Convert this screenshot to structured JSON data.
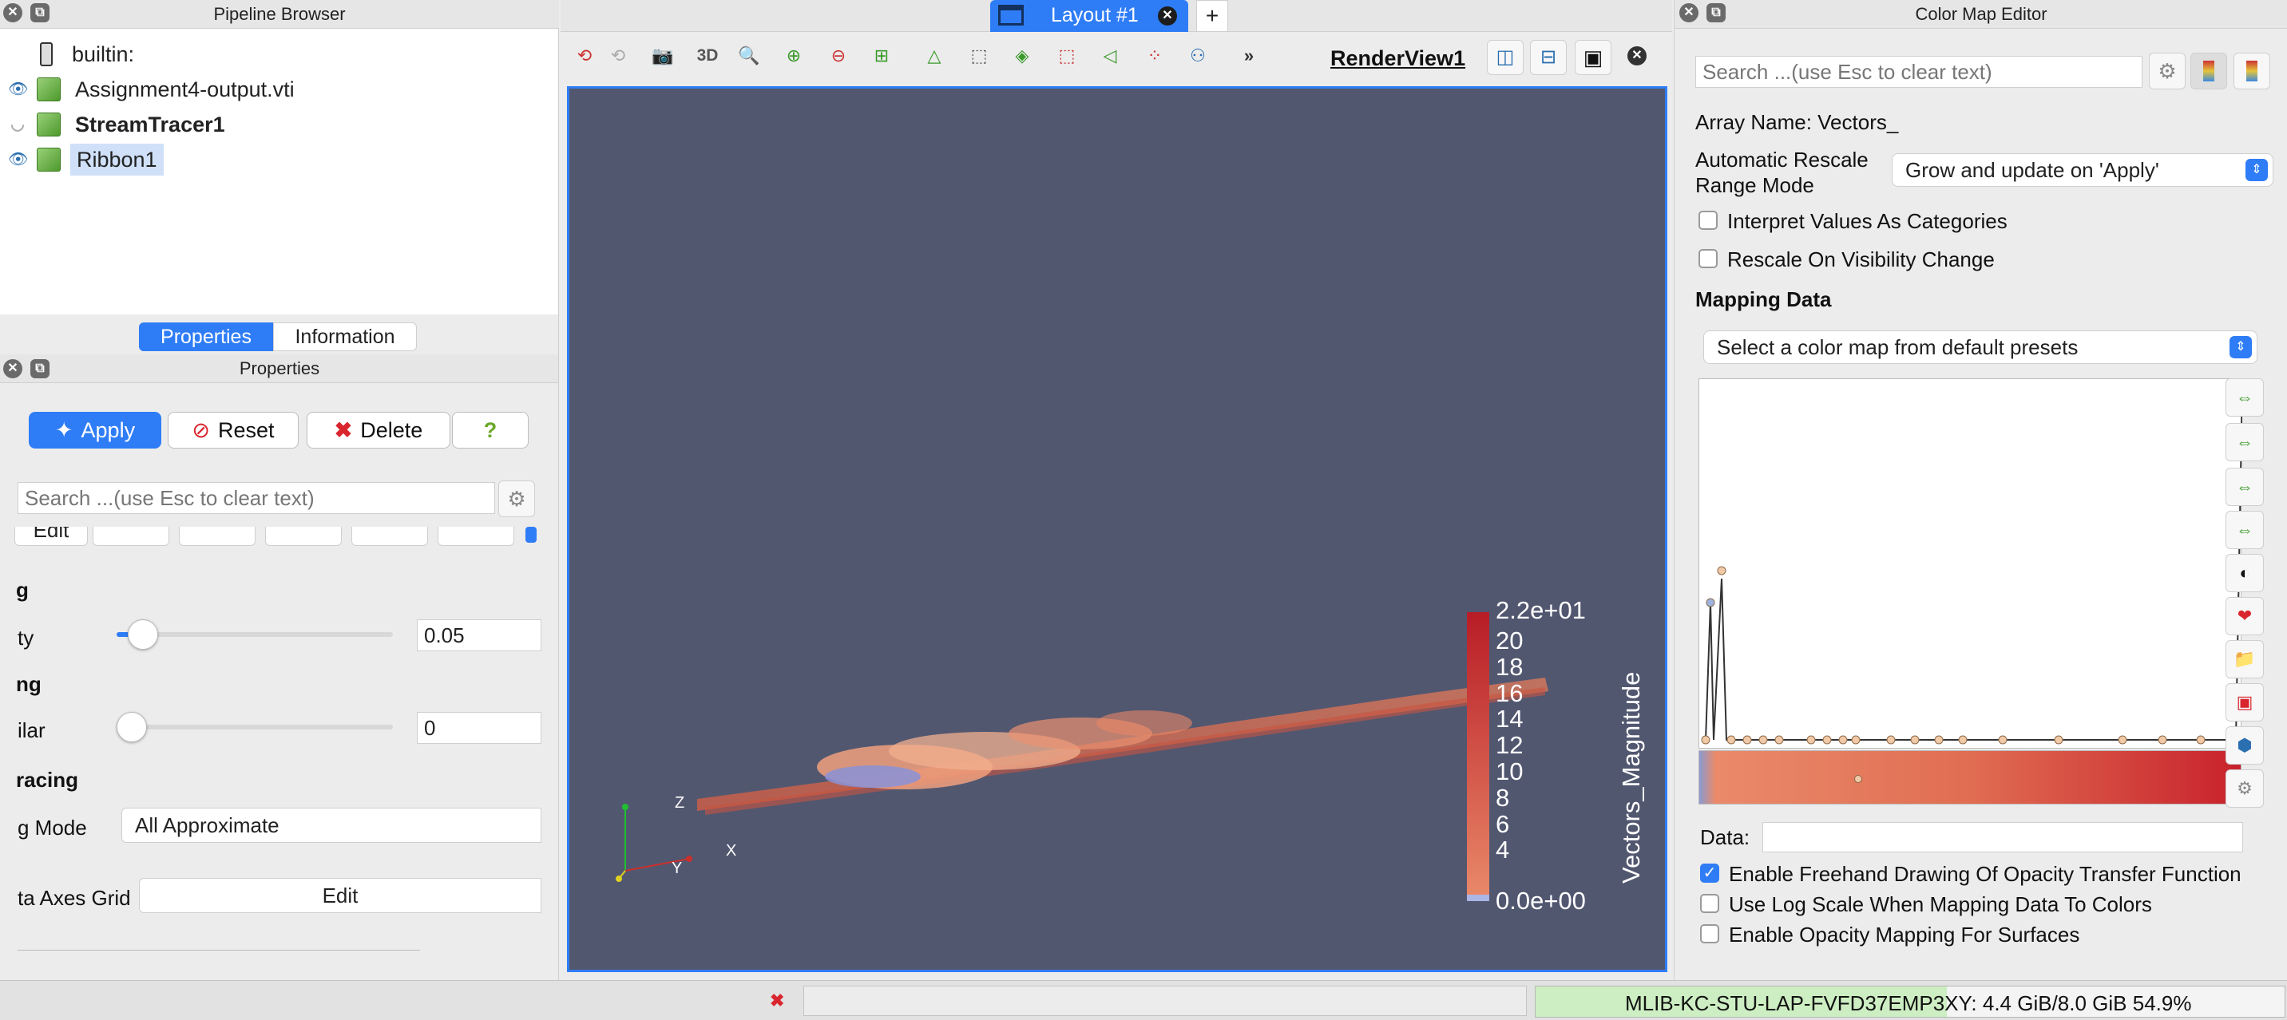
{
  "pipeline_browser": {
    "title": "Pipeline Browser",
    "items": [
      {
        "label": "builtin:"
      },
      {
        "label": "Assignment4-output.vti"
      },
      {
        "label": "StreamTracer1"
      },
      {
        "label": "Ribbon1"
      }
    ]
  },
  "panel_tabs": {
    "properties": "Properties",
    "information": "Information"
  },
  "properties": {
    "title": "Properties",
    "apply": "Apply",
    "reset": "Reset",
    "delete": "Delete",
    "help": "?",
    "search_placeholder": "Search ...(use Esc to clear text)",
    "edit_fragment": "Edit",
    "section1": "g",
    "row1_label": "ty",
    "row1_value": "0.05",
    "section2": "ng",
    "row2_label": "ilar",
    "row2_value": "0",
    "section3": "racing",
    "row3_label": "g Mode",
    "row3_value": "All Approximate",
    "row4_label": "ta Axes Grid",
    "row4_button": "Edit"
  },
  "layout_tab": {
    "label": "Layout #1",
    "add": "+"
  },
  "render_view": {
    "title": "RenderView1",
    "tool_3d": "3D",
    "colorbar": {
      "title": "Vectors_Magnitude",
      "ticks": [
        "2.2e+01",
        "20",
        "18",
        "16",
        "14",
        "12",
        "10",
        "8",
        "6",
        "4",
        "0.0e+00"
      ]
    },
    "axes": {
      "z": "Z",
      "x": "X",
      "y": "Y"
    }
  },
  "color_map_editor": {
    "title": "Color Map Editor",
    "search_placeholder": "Search ...(use Esc to clear text)",
    "array_name": "Array Name: Vectors_",
    "rescale_label": "Automatic Rescale Range Mode",
    "rescale_value": "Grow and update on 'Apply'",
    "interpret_categories": "Interpret Values As Categories",
    "rescale_visibility": "Rescale On Visibility Change",
    "mapping_data": "Mapping Data",
    "preset_select": "Select a color map from default presets",
    "data_label": "Data:",
    "opt_freehand": "Enable Freehand Drawing Of Opacity Transfer Function",
    "opt_logscale": "Use Log Scale When Mapping Data To Colors",
    "opt_opacity": "Enable Opacity Mapping For Surfaces"
  },
  "status_bar": {
    "memory": "MLIB-KC-STU-LAP-FVFD37EMP3XY: 4.4 GiB/8.0 GiB 54.9%",
    "memory_fraction": 0.549
  },
  "colors": {
    "accent": "#2f7df6",
    "render_bg": "#525770",
    "colormap_red": "#c8222c",
    "colormap_salmon": "#ea8a6a"
  }
}
